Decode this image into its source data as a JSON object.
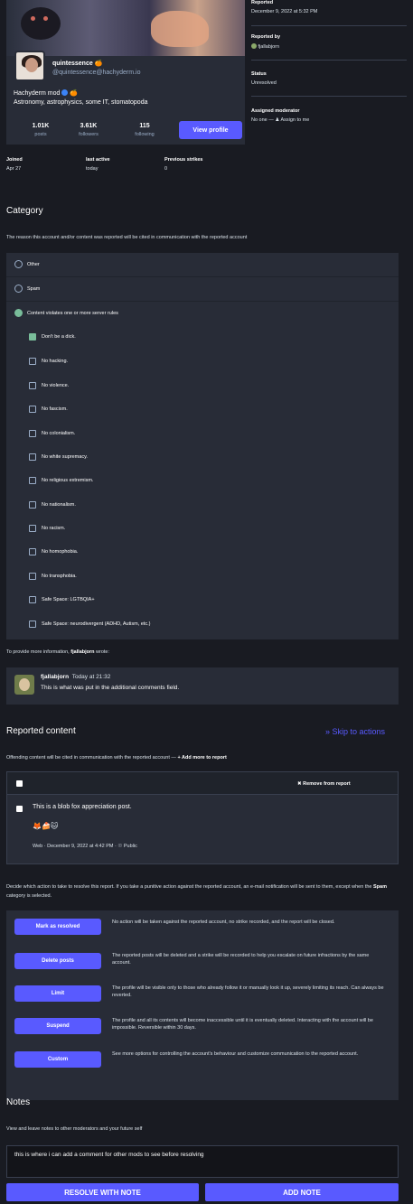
{
  "profile": {
    "name": "quintessence",
    "handle": "@quintessence@hachyderm.io",
    "bio_line1": "Hachyderm mod",
    "bio_line2": "Astronomy, astrophysics, some IT, stomatopoda",
    "stats": [
      {
        "value": "1.01K",
        "label": "posts"
      },
      {
        "value": "3.61K",
        "label": "followers"
      },
      {
        "value": "115",
        "label": "following"
      }
    ],
    "view_profile": "View profile",
    "joined_label": "Joined",
    "joined_value": "Apr 27",
    "last_active_label": "last active",
    "last_active_value": "today",
    "strikes_label": "Previous strikes",
    "strikes_value": "0"
  },
  "sidebar": {
    "reported_label": "Reported",
    "reported_value": "December 9, 2022 at 5:32 PM",
    "reported_by_label": "Reported by",
    "reported_by_value": "fjallabjorn",
    "status_label": "Status",
    "status_value": "Unresolved",
    "moderator_label": "Assigned moderator",
    "moderator_none": "No one",
    "assign_link": "Assign to me"
  },
  "category": {
    "title": "Category",
    "description": "The reason this account and/or content was reported will be cited in communication with the reported account",
    "options": [
      "Other",
      "Spam",
      "Content violates one or more server rules"
    ],
    "selected": "Content violates one or more server rules",
    "rules": [
      {
        "label": "Don't be a dick.",
        "checked": true
      },
      {
        "label": "No hacking.",
        "checked": false
      },
      {
        "label": "No violence.",
        "checked": false
      },
      {
        "label": "No fascism.",
        "checked": false
      },
      {
        "label": "No colonialism.",
        "checked": false
      },
      {
        "label": "No white supremacy.",
        "checked": false
      },
      {
        "label": "No religious extremism.",
        "checked": false
      },
      {
        "label": "No nationalism.",
        "checked": false
      },
      {
        "label": "No racism.",
        "checked": false
      },
      {
        "label": "No homophobia.",
        "checked": false
      },
      {
        "label": "No transphobia.",
        "checked": false
      },
      {
        "label": "Safe Space: LGTBQIA+",
        "checked": false
      },
      {
        "label": "Safe Space: neurodivergent (ADHD, Autism, etc.)",
        "checked": false
      }
    ]
  },
  "comment": {
    "intro_prefix": "To provide more information,",
    "intro_user": "fjallabjorn",
    "intro_suffix": "wrote:",
    "author": "fjallabjorn",
    "time": "Today at 21:32",
    "text": "This is what was put in the additional comments field."
  },
  "reported_content": {
    "title": "Reported content",
    "skip": "Skip to actions",
    "description_prefix": "Offending content will be cited in communication with the reported account —",
    "add_more": "Add more to report",
    "remove": "Remove from report",
    "post_text": "This is a blob fox appreciation post.",
    "post_meta": "Web · December 9, 2022 at 4:42 PM ·",
    "visibility": "Public"
  },
  "actions": {
    "intro_prefix": "Decide which action to take to resolve this report. If you take a punitive action against the reported account, an e-mail notification will be sent to them, except when the",
    "intro_bold": "Spam",
    "intro_suffix": "category is selected.",
    "items": [
      {
        "label": "Mark as resolved",
        "desc": "No action will be taken against the reported account, no strike recorded, and the report will be closed."
      },
      {
        "label": "Delete posts",
        "desc": "The reported posts will be deleted and a strike will be recorded to help you escalate on future infractions by the same account."
      },
      {
        "label": "Limit",
        "desc": "The profile will be visible only to those who already follow it or manually look it up, severely limiting its reach. Can always be reverted."
      },
      {
        "label": "Suspend",
        "desc": "The profile and all its contents will become inaccessible until it is eventually deleted. Interacting with the account will be impossible. Reversible within 30 days."
      },
      {
        "label": "Custom",
        "desc": "See more options for controlling the account's behaviour and customize communication to the reported account."
      }
    ]
  },
  "notes": {
    "title": "Notes",
    "description": "View and leave notes to other moderators and your future self",
    "value": "this is where i can add a comment for other mods to see before resolving",
    "resolve_btn": "RESOLVE WITH NOTE",
    "add_btn": "ADD NOTE"
  },
  "colors": {
    "accent": "#595aff",
    "green": "#79bd9a",
    "bg": "#191b22",
    "panel": "#282c37"
  }
}
